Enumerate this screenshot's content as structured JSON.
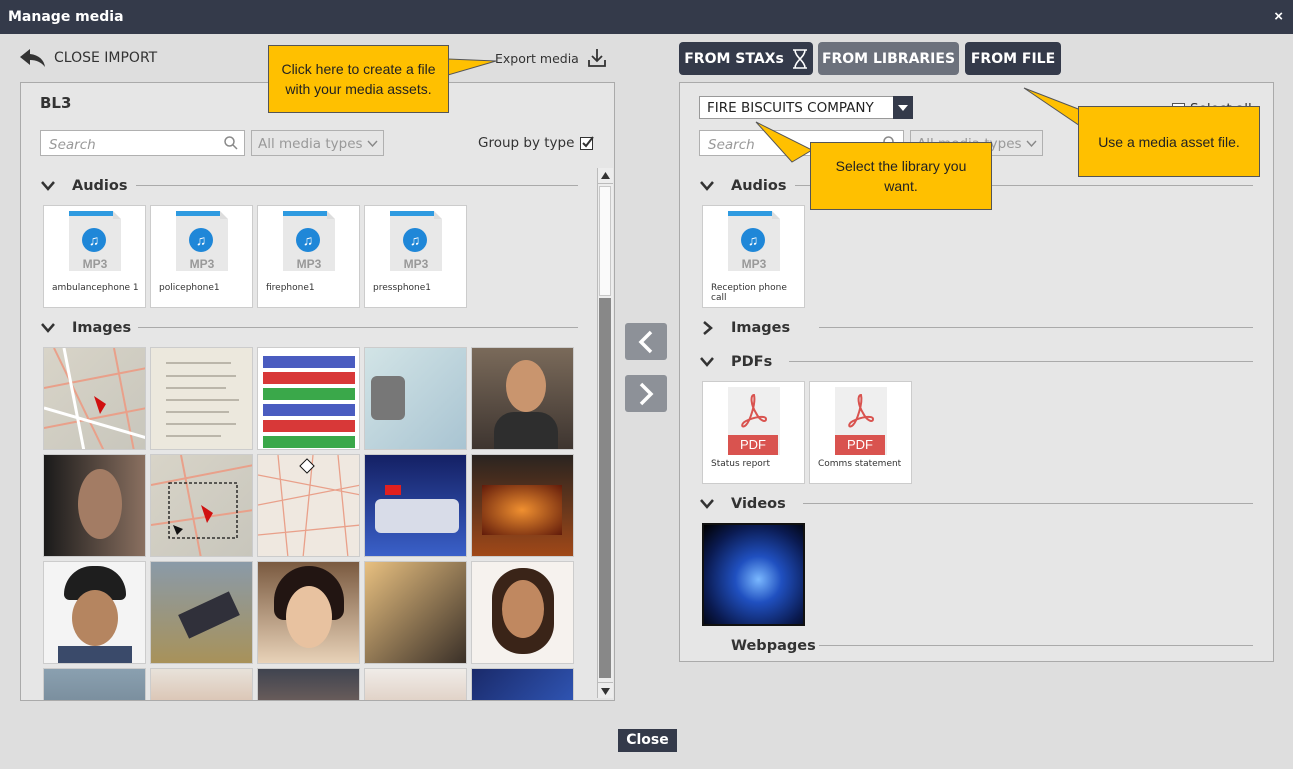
{
  "window": {
    "title": "Manage media",
    "close_icon": "×"
  },
  "left": {
    "close_import_label": "CLOSE IMPORT",
    "export_label": "Export media",
    "panel_title": "BL3",
    "search_placeholder": "Search",
    "media_type_filter": "All media types",
    "group_by_type_label": "Group by type",
    "group_by_type_checked": true,
    "sections": {
      "audios": "Audios",
      "images": "Images"
    },
    "audio_items": [
      {
        "name": "ambulancephone 1",
        "format": "MP3"
      },
      {
        "name": "policephone1",
        "format": "MP3"
      },
      {
        "name": "firephone1",
        "format": "MP3"
      },
      {
        "name": "pressphone1",
        "format": "MP3"
      }
    ]
  },
  "right": {
    "source_buttons": {
      "stax": "FROM STAXs",
      "libraries": "FROM LIBRARIES",
      "file": "FROM FILE"
    },
    "library_selected": "FIRE BISCUITS COMPANY",
    "select_all_label": "Select all",
    "search_placeholder": "Search",
    "media_type_filter": "All media types",
    "sections": {
      "audios": "Audios",
      "images": "Images",
      "pdfs": "PDFs",
      "videos": "Videos",
      "webpages": "Webpages"
    },
    "audio_items": [
      {
        "name": "Reception phone call",
        "format": "MP3"
      }
    ],
    "pdf_items": [
      {
        "name": "Status report",
        "format": "PDF"
      },
      {
        "name": "Comms statement",
        "format": "PDF"
      }
    ]
  },
  "callouts": {
    "export": "Click here to create a file with your media assets.",
    "library": "Select the library you want.",
    "file": "Use a media asset file."
  },
  "footer": {
    "close_label": "Close"
  },
  "colors": {
    "titlebar": "#343a4a",
    "callout": "#ffc000",
    "accent_blue": "#1f87d8",
    "pdf_red": "#d9534f"
  }
}
